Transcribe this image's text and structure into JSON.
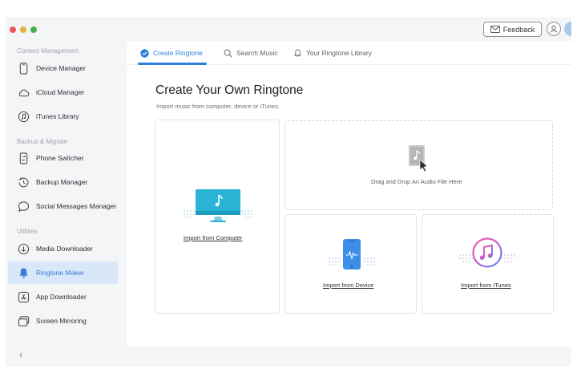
{
  "window": {
    "feedback_label": "Feedback"
  },
  "sidebar": {
    "sections": [
      {
        "label": "Content Management"
      },
      {
        "label": "Backup & Migrate"
      },
      {
        "label": "Utilities"
      }
    ],
    "items": [
      {
        "label": "Device Manager",
        "icon": "phone-icon"
      },
      {
        "label": "iCloud Manager",
        "icon": "cloud-icon"
      },
      {
        "label": "iTunes Library",
        "icon": "music-disc-icon"
      },
      {
        "label": "Phone Switcher",
        "icon": "phone-switch-icon"
      },
      {
        "label": "Backup Manager",
        "icon": "clock-history-icon"
      },
      {
        "label": "Social Messages Manager",
        "icon": "chat-bubble-icon"
      },
      {
        "label": "Media Downloader",
        "icon": "download-icon"
      },
      {
        "label": "Ringtone Maker",
        "icon": "bell-icon",
        "active": true
      },
      {
        "label": "App Downloader",
        "icon": "app-store-icon"
      },
      {
        "label": "Screen Mirroring",
        "icon": "screen-mirror-icon"
      }
    ],
    "collapse_glyph": "‹"
  },
  "tabs": [
    {
      "label": "Create Ringtone",
      "icon": "check-circle-icon",
      "active": true
    },
    {
      "label": "Search Music",
      "icon": "search-icon"
    },
    {
      "label": "Your Ringtone Library",
      "icon": "bell-icon"
    }
  ],
  "main": {
    "title": "Create Your Own Ringtone",
    "subtitle": "Import music from computer, device or iTunes.",
    "drop_text": "Drag and Drop An Audio File Here",
    "import_computer": "Import from Computer",
    "import_device": "Import from Device",
    "import_itunes": "Import from iTunes"
  },
  "colors": {
    "accent": "#2f7fd8",
    "active_bg": "#d8e8f8",
    "monitor": "#2bb3d6",
    "phone": "#3d8ee8",
    "itunes": "#c45ad9"
  }
}
